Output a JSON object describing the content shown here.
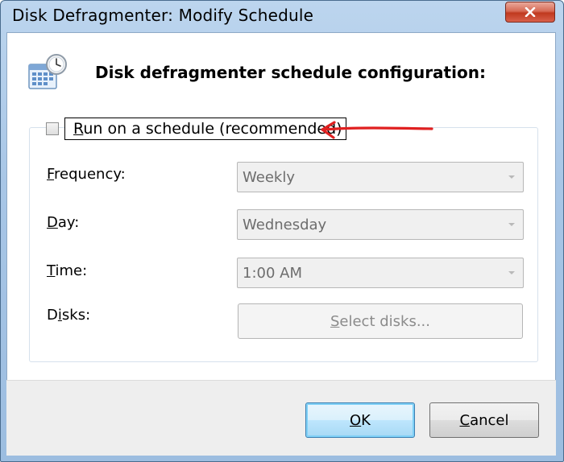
{
  "window": {
    "title": "Disk Defragmenter: Modify Schedule"
  },
  "header": {
    "text": "Disk defragmenter schedule configuration:",
    "icon": "calendar-clock-icon"
  },
  "schedule": {
    "checkbox_label_first": "R",
    "checkbox_label_rest": "un on a schedule (recommended)",
    "checked": false
  },
  "fields": {
    "frequency_label_first": "F",
    "frequency_label_rest": "requency:",
    "frequency_value": "Weekly",
    "day_label_first": "D",
    "day_label_rest": "ay:",
    "day_value": "Wednesday",
    "time_label_first": "T",
    "time_label_rest": "ime:",
    "time_value": "1:00 AM",
    "disks_label_pre": "D",
    "disks_label_u": "i",
    "disks_label_rest": "sks:",
    "select_disks_pre": "",
    "select_disks_u": "S",
    "select_disks_rest": "elect disks..."
  },
  "buttons": {
    "ok_u": "O",
    "ok_rest": "K",
    "cancel_u": "C",
    "cancel_rest": "ancel"
  },
  "colors": {
    "annotation_arrow": "#e02020"
  }
}
